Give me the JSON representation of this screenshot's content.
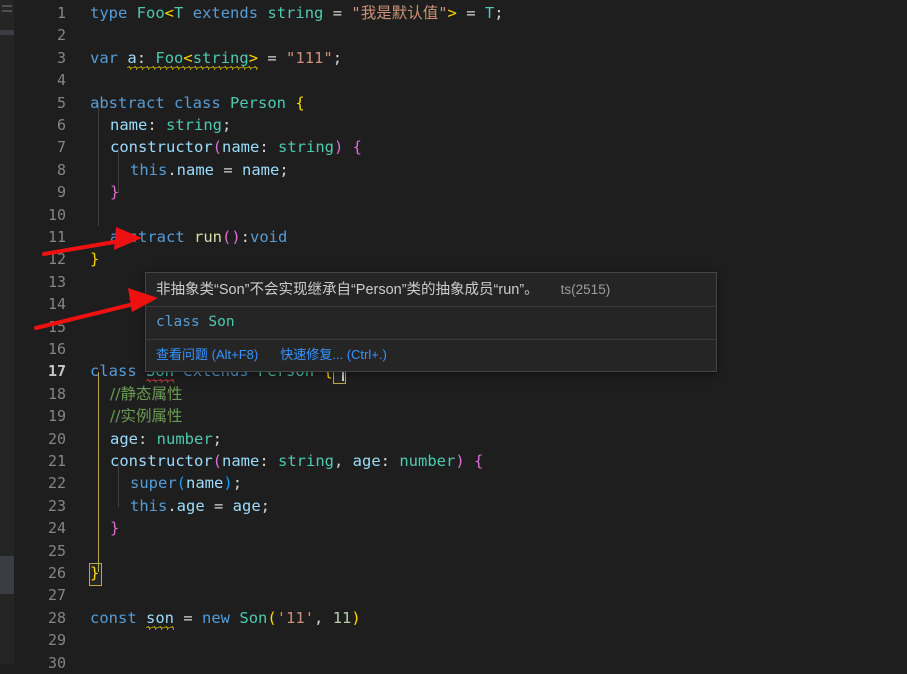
{
  "app": {
    "kind": "code-editor",
    "theme_background": "#1e1e1e",
    "gutter_color": "#858585",
    "active_line": 17
  },
  "editor": {
    "lines": [
      {
        "n": "1",
        "text": "type Foo<T extends string = \"我是默认值\"> = T;"
      },
      {
        "n": "2",
        "text": ""
      },
      {
        "n": "3",
        "text": "var a: Foo<string> = \"111\";"
      },
      {
        "n": "4",
        "text": ""
      },
      {
        "n": "5",
        "text": "abstract class Person {"
      },
      {
        "n": "6",
        "text": "  name: string;"
      },
      {
        "n": "7",
        "text": "  constructor(name: string) {"
      },
      {
        "n": "8",
        "text": "    this.name = name;"
      },
      {
        "n": "9",
        "text": "  }"
      },
      {
        "n": "10",
        "text": ""
      },
      {
        "n": "11",
        "text": "  abstract run():void"
      },
      {
        "n": "12",
        "text": "}"
      },
      {
        "n": "13",
        "text": ""
      },
      {
        "n": "14",
        "text": ""
      },
      {
        "n": "15",
        "text": ""
      },
      {
        "n": "16",
        "text": ""
      },
      {
        "n": "17",
        "text": "class Son extends Person {"
      },
      {
        "n": "18",
        "text": "  //静态属性"
      },
      {
        "n": "19",
        "text": "  //实例属性"
      },
      {
        "n": "20",
        "text": "  age: number;"
      },
      {
        "n": "21",
        "text": "  constructor(name: string, age: number) {"
      },
      {
        "n": "22",
        "text": "    super(name);"
      },
      {
        "n": "23",
        "text": "    this.age = age;"
      },
      {
        "n": "24",
        "text": "  }"
      },
      {
        "n": "25",
        "text": ""
      },
      {
        "n": "26",
        "text": "}"
      },
      {
        "n": "27",
        "text": ""
      },
      {
        "n": "28",
        "text": "const son = new Son('11', 11)"
      },
      {
        "n": "29",
        "text": ""
      },
      {
        "n": "30",
        "text": ""
      }
    ],
    "tokens": {
      "l1": {
        "kw_type": "type",
        "name": "Foo",
        "lt": "<",
        "t": "T",
        "kw_extends": "extends",
        "prim": "string",
        "eq": " = ",
        "default": "\"我是默认值\"",
        "gt": ">",
        "eq2": " = ",
        "ret": "T",
        "semi": ";"
      },
      "l3": {
        "kw_var": "var",
        "name": "a",
        "colon": ": ",
        "type": "Foo",
        "lt": "<",
        "prim": "string",
        "gt": ">",
        "eq": " = ",
        "val": "\"111\"",
        "semi": ";"
      },
      "l5": {
        "kw_abstract": "abstract",
        "kw_class": "class",
        "name": "Person",
        "brace": "{"
      },
      "l6": {
        "prop": "name",
        "colon": ": ",
        "type": "string",
        "semi": ";"
      },
      "l7": {
        "kw": "constructor",
        "lp": "(",
        "param": "name",
        "colon": ": ",
        "type": "string",
        "rp": ")",
        "brace": " {"
      },
      "l8": {
        "kw_this": "this",
        "dot": ".",
        "prop": "name",
        "eq": " = ",
        "val": "name",
        "semi": ";"
      },
      "l9": {
        "brace": "}"
      },
      "l11": {
        "kw_abstract": "abstract",
        "fn": "run",
        "parens": "()",
        "colon": ":",
        "type": "void"
      },
      "l12": {
        "brace": "}"
      },
      "l17": {
        "kw_class": "class",
        "name": "Son",
        "kw_extends": "extends",
        "base": "Person",
        "brace": "{"
      },
      "l18": {
        "comment": "//静态属性"
      },
      "l19": {
        "comment": "//实例属性"
      },
      "l20": {
        "prop": "age",
        "colon": ": ",
        "type": "number",
        "semi": ";"
      },
      "l21": {
        "kw": "constructor",
        "lp": "(",
        "p1": "name",
        "c1": ": ",
        "t1": "string",
        "comma": ", ",
        "p2": "age",
        "c2": ": ",
        "t2": "number",
        "rp": ")",
        "brace": " {"
      },
      "l22": {
        "kw_super": "super",
        "lp": "(",
        "arg": "name",
        "rp": ")",
        "semi": ";"
      },
      "l23": {
        "kw_this": "this",
        "dot": ".",
        "prop": "age",
        "eq": " = ",
        "val": "age",
        "semi": ";"
      },
      "l24": {
        "brace": "}"
      },
      "l26": {
        "brace": "}"
      },
      "l28": {
        "kw_const": "const",
        "name": "son",
        "eq": " = ",
        "kw_new": "new",
        "cls": "Son",
        "lp": "(",
        "s1": "'11'",
        "comma": ", ",
        "n1": "11",
        "rp": ")"
      }
    }
  },
  "tooltip": {
    "message": "非抽象类“Son”不会实现继承自“Person”类的抽象成员“run”。",
    "error_code": "ts(2515)",
    "code_preview_keyword": "class",
    "code_preview_name": "Son",
    "action_view_problem": "查看问题",
    "action_view_problem_shortcut": "(Alt+F8)",
    "action_quick_fix": "快速修复...",
    "action_quick_fix_shortcut": "(Ctrl+.)"
  },
  "annotations": {
    "arrow_color": "#ee1111",
    "arrow_1_target": "abstract run():void",
    "arrow_2_target": "非抽象类“Son”不会实现继承自“Person”类的抽象成员“run”。"
  },
  "colors": {
    "keyword": "#569cd6",
    "type": "#4ec9b0",
    "variable": "#9cdcfe",
    "string": "#ce9178",
    "number": "#b5cea8",
    "comment": "#6a9955",
    "function": "#dcdcaa",
    "bracket_gold": "#ffd700",
    "bracket_pink": "#da70d6",
    "bracket_blue": "#179fff",
    "link": "#3794ff",
    "error_squiggle": "#d13b3b",
    "warn_squiggle": "#cbb700"
  }
}
